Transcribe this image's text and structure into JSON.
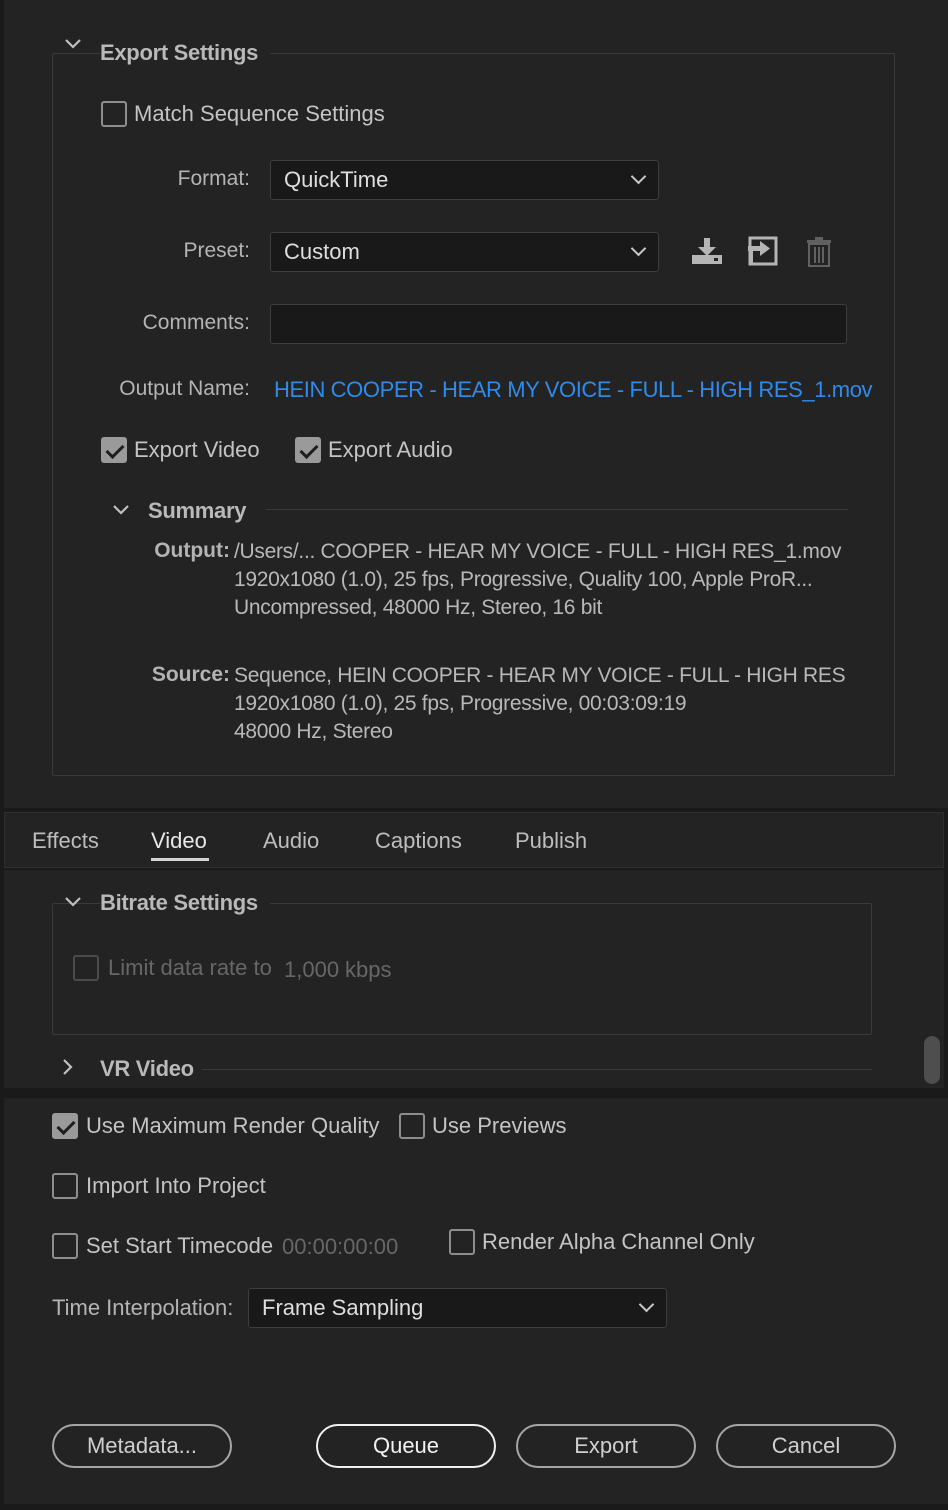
{
  "export_settings": {
    "title": "Export Settings",
    "match_sequence_label": "Match Sequence Settings",
    "match_sequence_checked": false,
    "format_label": "Format:",
    "format_value": "QuickTime",
    "preset_label": "Preset:",
    "preset_value": "Custom",
    "preset_icons": [
      "save-preset-icon",
      "import-preset-icon",
      "delete-preset-icon"
    ],
    "comments_label": "Comments:",
    "comments_value": "",
    "output_name_label": "Output Name:",
    "output_name_value": "HEIN COOPER - HEAR MY VOICE - FULL - HIGH RES_1.mov",
    "export_video_label": "Export Video",
    "export_video_checked": true,
    "export_audio_label": "Export Audio",
    "export_audio_checked": true
  },
  "summary": {
    "title": "Summary",
    "output_key": "Output:",
    "output_lines": [
      "/Users/... COOPER - HEAR MY VOICE - FULL - HIGH RES_1.mov",
      "1920x1080 (1.0), 25 fps, Progressive, Quality 100, Apple ProR...",
      "Uncompressed, 48000 Hz, Stereo, 16 bit"
    ],
    "source_key": "Source:",
    "source_lines": [
      "Sequence, HEIN COOPER - HEAR MY VOICE - FULL - HIGH RES",
      "1920x1080 (1.0), 25 fps, Progressive, 00:03:09:19",
      "48000 Hz, Stereo"
    ]
  },
  "tabs": {
    "items": [
      "Effects",
      "Video",
      "Audio",
      "Captions",
      "Publish"
    ],
    "active": "Video"
  },
  "bitrate": {
    "title": "Bitrate Settings",
    "limit_label": "Limit data rate to",
    "limit_value": "1,000",
    "limit_unit": "kbps",
    "limit_checked": false
  },
  "vr_video": {
    "title": "VR Video"
  },
  "render_options": {
    "max_render_quality_label": "Use Maximum Render Quality",
    "max_render_quality_checked": true,
    "use_previews_label": "Use Previews",
    "use_previews_checked": false,
    "import_into_project_label": "Import Into Project",
    "import_into_project_checked": false,
    "set_start_timecode_label": "Set Start Timecode",
    "set_start_timecode_value": "00:00:00:00",
    "set_start_timecode_checked": false,
    "render_alpha_label": "Render Alpha Channel Only",
    "render_alpha_checked": false,
    "time_interpolation_label": "Time Interpolation:",
    "time_interpolation_value": "Frame Sampling"
  },
  "buttons": {
    "metadata": "Metadata...",
    "queue": "Queue",
    "export": "Export",
    "cancel": "Cancel"
  },
  "colors": {
    "link": "#2d8ceb",
    "panel": "#232323",
    "field": "#191919"
  }
}
